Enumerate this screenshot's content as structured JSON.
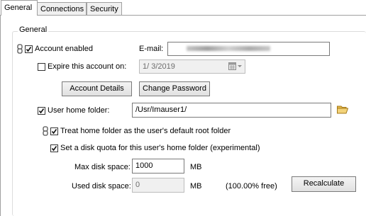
{
  "tabs": [
    "General",
    "Connections",
    "Security"
  ],
  "group_title": "General",
  "account_enabled": {
    "label": "Account enabled",
    "checked": true
  },
  "email": {
    "label": "E-mail:",
    "value": ""
  },
  "expire": {
    "label": "Expire this account on:",
    "checked": false,
    "date": "1/  3/2019"
  },
  "buttons": {
    "account_details": "Account Details",
    "change_password": "Change Password",
    "recalculate": "Recalculate"
  },
  "home_folder": {
    "label": "User home folder:",
    "checked": true,
    "value": "/Usr/Imauser1/"
  },
  "treat_root": {
    "label": "Treat home folder as the user's default root folder",
    "checked": true
  },
  "disk_quota": {
    "label": "Set a disk quota for this user's home folder (experimental)",
    "checked": true
  },
  "max_disk": {
    "label": "Max disk space:",
    "value": "1000",
    "unit": "MB"
  },
  "used_disk": {
    "label": "Used disk space:",
    "value": "0",
    "unit": "MB",
    "free": "(100.00% free)"
  },
  "icons": {
    "link": "link-icon",
    "folder": "folder-icon",
    "calendar": "calendar-icon"
  },
  "colors": {
    "tab_active": "#ffffff",
    "tab_inactive": "#f0f0f0",
    "folder": "#e6b94a"
  }
}
